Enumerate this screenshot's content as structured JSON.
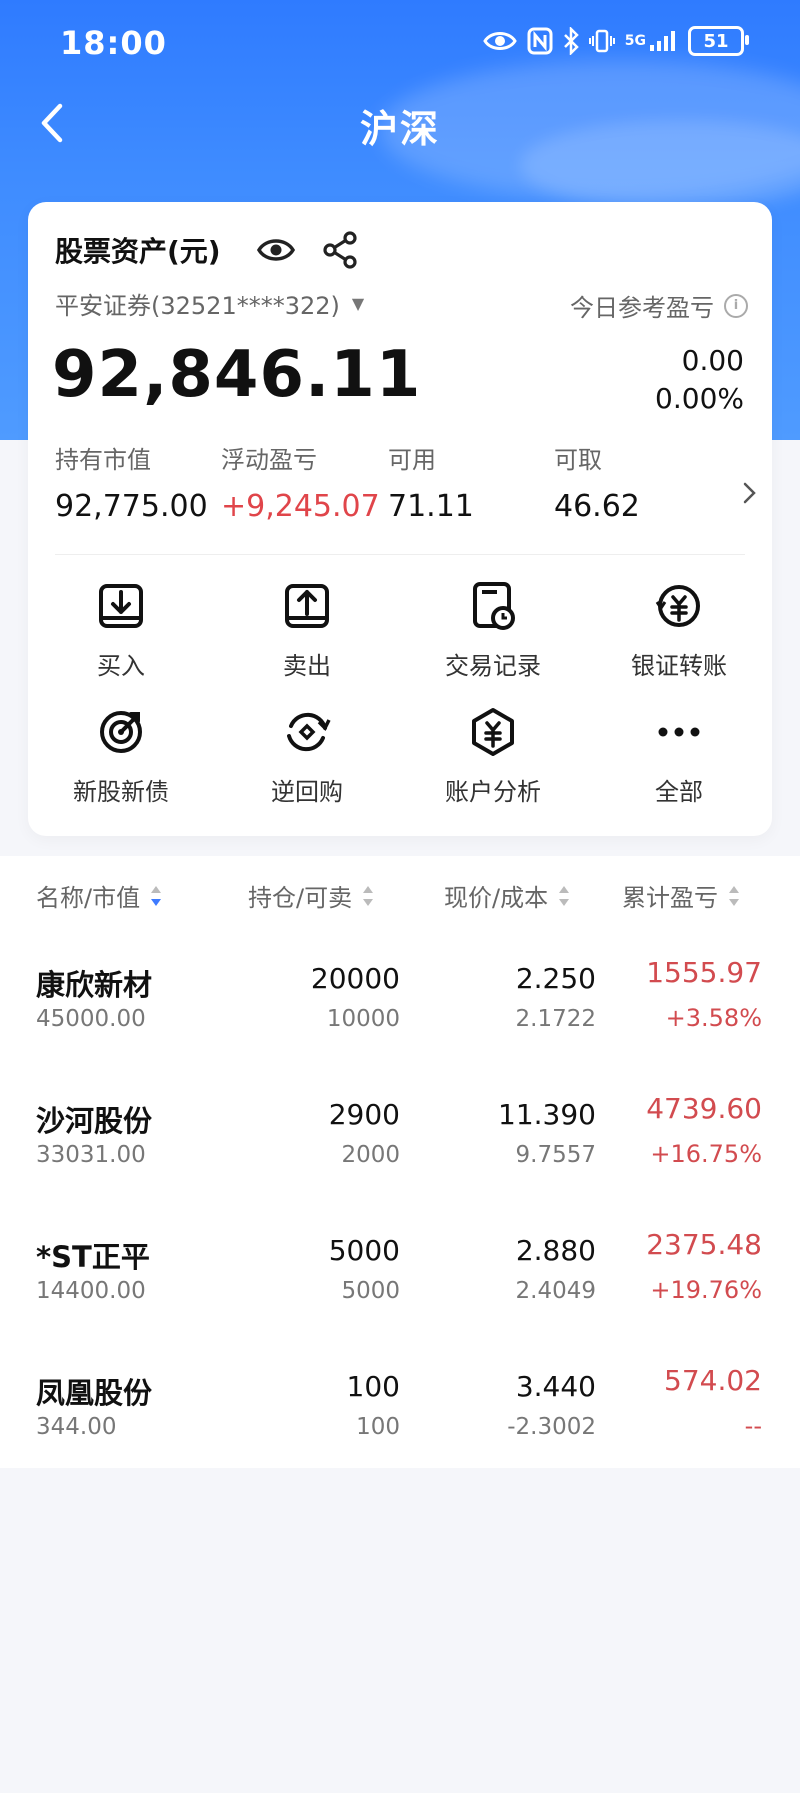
{
  "status_bar": {
    "time": "18:00",
    "network": "5G",
    "battery": "51"
  },
  "header": {
    "title": "沪深"
  },
  "asset_card": {
    "title": "股票资产(元)",
    "broker": "平安证券(32521****322)",
    "total": "92,846.11",
    "today_label": "今日参考盈亏",
    "today_amount": "0.00",
    "today_pct": "0.00%",
    "stats": [
      {
        "label": "持有市值",
        "value": "92,775.00"
      },
      {
        "label": "浮动盈亏",
        "value": "+9,245.07"
      },
      {
        "label": "可用",
        "value": "71.11"
      },
      {
        "label": "可取",
        "value": "46.62"
      }
    ]
  },
  "actions": [
    {
      "label": "买入",
      "icon": "buy-icon"
    },
    {
      "label": "卖出",
      "icon": "sell-icon"
    },
    {
      "label": "交易记录",
      "icon": "trade-record-icon"
    },
    {
      "label": "银证转账",
      "icon": "bank-transfer-icon"
    },
    {
      "label": "新股新债",
      "icon": "ipo-icon"
    },
    {
      "label": "逆回购",
      "icon": "reverse-repo-icon"
    },
    {
      "label": "账户分析",
      "icon": "account-analysis-icon"
    },
    {
      "label": "全部",
      "icon": "more-icon"
    }
  ],
  "table": {
    "headers": [
      "名称/市值",
      "持仓/可卖",
      "现价/成本",
      "累计盈亏"
    ],
    "rows": [
      {
        "name": "康欣新材",
        "market_value": "45000.00",
        "position": "20000",
        "available": "10000",
        "price": "2.250",
        "cost": "2.1722",
        "pl": "1555.97",
        "pl_pct": "+3.58%"
      },
      {
        "name": "沙河股份",
        "market_value": "33031.00",
        "position": "2900",
        "available": "2000",
        "price": "11.390",
        "cost": "9.7557",
        "pl": "4739.60",
        "pl_pct": "+16.75%"
      },
      {
        "name": "*ST正平",
        "market_value": "14400.00",
        "position": "5000",
        "available": "5000",
        "price": "2.880",
        "cost": "2.4049",
        "pl": "2375.48",
        "pl_pct": "+19.76%"
      },
      {
        "name": "凤凰股份",
        "market_value": "344.00",
        "position": "100",
        "available": "100",
        "price": "3.440",
        "cost": "-2.3002",
        "pl": "574.02",
        "pl_pct": "--"
      }
    ]
  },
  "colors": {
    "primary": "#3f8cff",
    "profit": "#d24b4f",
    "sort_active": "#3f7bff"
  }
}
